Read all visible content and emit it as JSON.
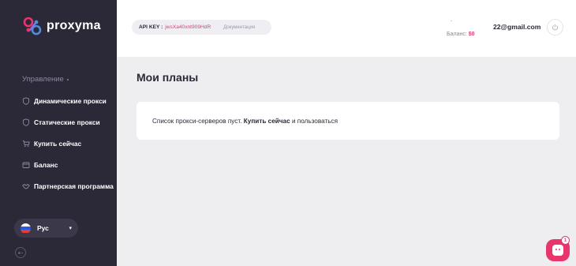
{
  "brand": {
    "name": "proxyma"
  },
  "sidebar": {
    "section_label": "Управление",
    "items": [
      {
        "label": "Динамические прокси",
        "icon": "shield-icon"
      },
      {
        "label": "Статические прокси",
        "icon": "shield-icon"
      },
      {
        "label": "Купить сейчас",
        "icon": "cart-icon"
      },
      {
        "label": "Баланс",
        "icon": "wallet-icon"
      },
      {
        "label": "Партнерская программа",
        "icon": "handshake-icon"
      }
    ],
    "language": {
      "label": "Рус",
      "flag": "russia-flag-icon"
    }
  },
  "header": {
    "api_key_label": "API KEY :",
    "api_key_value": "jwsXa40xnt909HdR",
    "docs_label": "Документация",
    "balance_dash": "-",
    "balance_label": "Баланс:",
    "balance_value": "$0",
    "user_email": "22@gmail.com"
  },
  "main": {
    "title": "Мои планы",
    "empty_text_before": "Список прокси-серверов пуст.",
    "empty_link": "Купить сейчас",
    "empty_text_after": "и пользоваться"
  },
  "chat": {
    "badge_count": "1"
  },
  "colors": {
    "sidebar_bg": "#2b2838",
    "accent": "#e8356b",
    "page_bg": "#eeeef1"
  }
}
